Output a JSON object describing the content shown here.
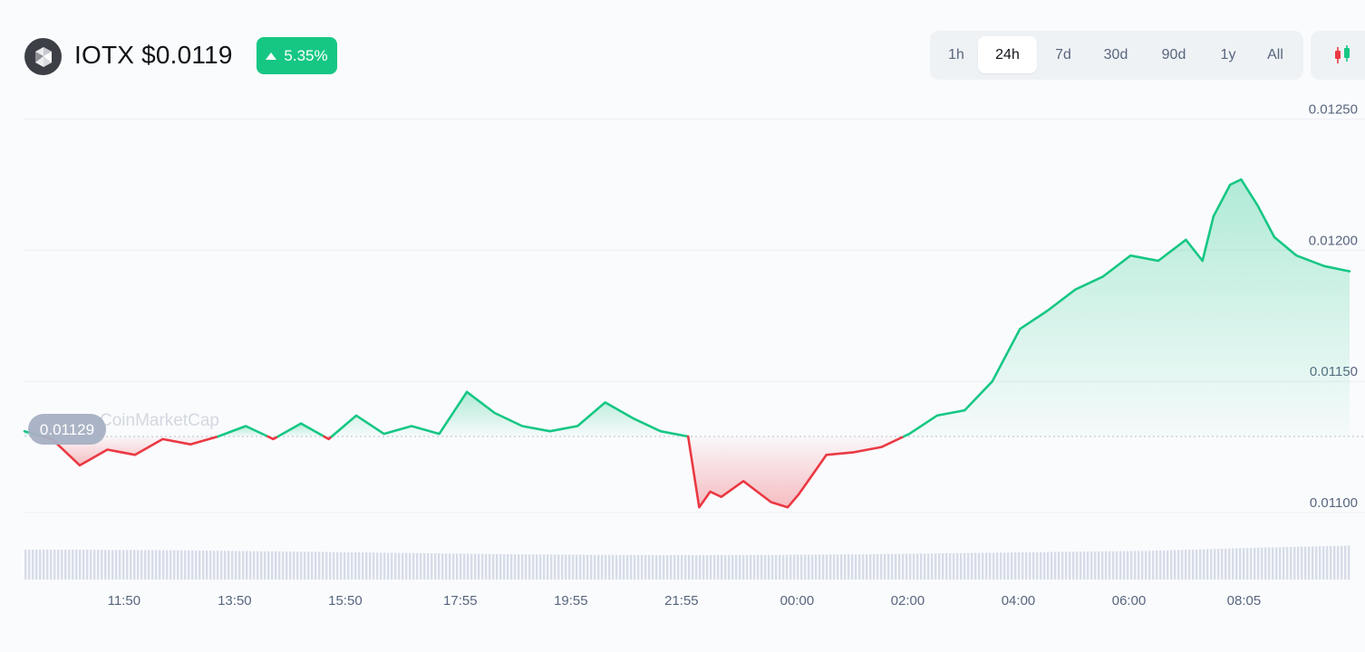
{
  "header": {
    "coin_symbol_price": "IOTX $0.0119",
    "change_percent": "5.35%",
    "change_direction": "up",
    "icons": {
      "coin_logo": "iotex-logo-icon",
      "change_arrow": "triangle-up-icon",
      "chart_toggle": "candlestick-icon"
    }
  },
  "range_tabs": [
    {
      "label": "1h",
      "active": false
    },
    {
      "label": "24h",
      "active": true
    },
    {
      "label": "7d",
      "active": false
    },
    {
      "label": "30d",
      "active": false
    },
    {
      "label": "90d",
      "active": false
    },
    {
      "label": "1y",
      "active": false
    },
    {
      "label": "All",
      "active": false
    }
  ],
  "colors": {
    "up": "#16c784",
    "down": "#ea3943",
    "grid": "#eceff3",
    "volume": "#cfd6e4",
    "text_muted": "#58667e",
    "baseline_badge": "#a6b0c3"
  },
  "chart_data": {
    "type": "area",
    "title": "",
    "xlabel": "",
    "ylabel": "",
    "ylim": [
      0.0109,
      0.01254
    ],
    "y_ticks": [
      "0.01250",
      "0.01200",
      "0.01150",
      "0.01100"
    ],
    "y_tick_values": [
      0.0125,
      0.012,
      0.0115,
      0.011
    ],
    "x_ticks": [
      "11:50",
      "13:50",
      "15:50",
      "17:55",
      "19:55",
      "21:55",
      "00:00",
      "02:00",
      "04:00",
      "06:00",
      "08:05"
    ],
    "x_tick_hours": [
      1.8,
      3.8,
      5.8,
      7.88,
      9.88,
      11.88,
      13.97,
      15.97,
      17.97,
      19.97,
      22.05
    ],
    "xlim_hours": [
      0,
      23.96
    ],
    "baseline": {
      "value": 0.01129,
      "label": "0.01129"
    },
    "watermark": "CoinMarketCap",
    "series": [
      {
        "x_hours": [
          0,
          0.5,
          1,
          1.5,
          2,
          2.5,
          3,
          3.5,
          4,
          4.5,
          5,
          5.5,
          6,
          6.5,
          7,
          7.5,
          8,
          8.5,
          9,
          9.5,
          10,
          10.5,
          11,
          11.5,
          12,
          12.2,
          12.4,
          12.6,
          13,
          13.5,
          13.8,
          14,
          14.5,
          15,
          15.5,
          16,
          16.5,
          17,
          17.5,
          18,
          18.5,
          19,
          19.5,
          20,
          20.5,
          21,
          21.3,
          21.5,
          21.8,
          22,
          22.3,
          22.6,
          23,
          23.5,
          23.96
        ],
        "values": [
          0.01131,
          0.01128,
          0.01118,
          0.01124,
          0.01122,
          0.01128,
          0.01126,
          0.01129,
          0.01133,
          0.01128,
          0.01134,
          0.01128,
          0.01137,
          0.0113,
          0.01133,
          0.0113,
          0.01146,
          0.01138,
          0.01133,
          0.01131,
          0.01133,
          0.01142,
          0.01136,
          0.01131,
          0.01129,
          0.01102,
          0.01108,
          0.01106,
          0.01112,
          0.01104,
          0.01102,
          0.01107,
          0.01122,
          0.01123,
          0.01125,
          0.0113,
          0.01137,
          0.01139,
          0.0115,
          0.0117,
          0.01177,
          0.01185,
          0.0119,
          0.01198,
          0.01196,
          0.01204,
          0.01196,
          0.01213,
          0.01225,
          0.01227,
          0.01217,
          0.01205,
          0.01198,
          0.01194,
          0.01192
        ]
      }
    ],
    "volume_bars_note": ""
  }
}
